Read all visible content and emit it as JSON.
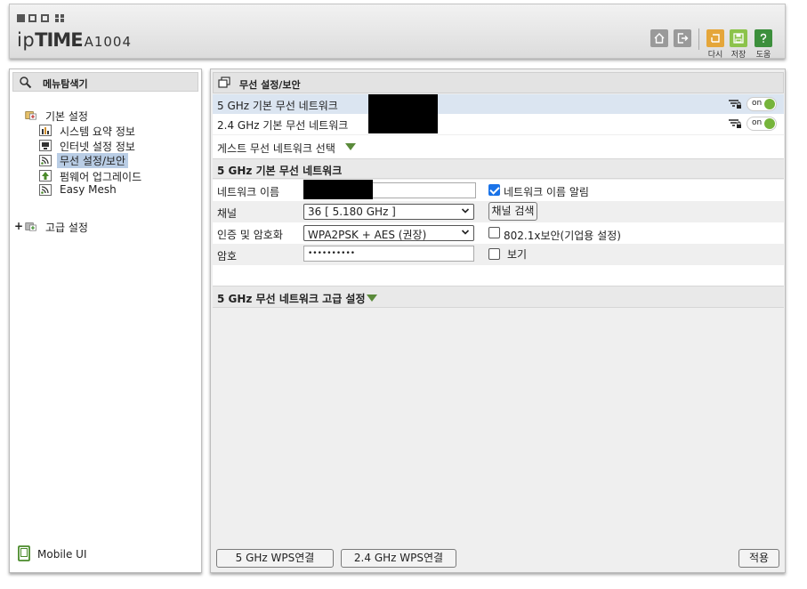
{
  "header": {
    "brand_ip": "ip",
    "brand_time": "TIME",
    "model": "A1004",
    "buttons": {
      "reset_label": "다시",
      "save_label": "저장",
      "help_label": "도움"
    }
  },
  "sidebar": {
    "title": "메뉴탐색기",
    "basic": {
      "label": "기본 설정",
      "items": [
        {
          "label": "시스템 요약 정보",
          "icon": "chart-icon"
        },
        {
          "label": "인터넷 설정 정보",
          "icon": "computer-icon"
        },
        {
          "label": "무선 설정/보안",
          "icon": "wireless-icon",
          "selected": true
        },
        {
          "label": "펌웨어 업그레이드",
          "icon": "firmware-icon"
        },
        {
          "label": "Easy Mesh",
          "icon": "wireless-icon"
        }
      ]
    },
    "advanced": {
      "expander": "+",
      "label": "고급 설정"
    },
    "mobile_ui": "Mobile UI"
  },
  "main": {
    "title": "무선 설정/보안",
    "networks": [
      {
        "label": "5 GHz 기본 무선 네트워크",
        "toggle": "on"
      },
      {
        "label": "2.4 GHz 기본 무선 네트워크",
        "toggle": "on"
      }
    ],
    "guest_select": "게스트 무선 네트워크 선택",
    "basic_section": {
      "title": "5 GHz 기본 무선 네트워크",
      "network_name_label": "네트워크 이름",
      "broadcast_label": "네트워크 이름 알림",
      "broadcast_checked": true,
      "channel_label": "채널",
      "channel_value": "36 [ 5.180 GHz ]",
      "channel_search": "채널 검색",
      "auth_label": "인증 및 암호화",
      "auth_value": "WPA2PSK + AES (권장)",
      "enterprise_label": "802.1x보안(기업용 설정)",
      "enterprise_checked": false,
      "password_label": "암호",
      "password_value": "••••••••••",
      "show_label": "보기",
      "show_checked": false
    },
    "advanced_section_title": "5 GHz 무선 네트워크 고급 설정",
    "footer": {
      "wps5": "5 GHz WPS연결",
      "wps24": "2.4 GHz WPS연결",
      "apply": "적용"
    }
  },
  "colors": {
    "selected_bg": "#b9cde5",
    "network_row_highlight": "#dbe5f1",
    "toggle_green": "#76b43b",
    "reset_btn": "#e5a63a",
    "save_btn": "#8cc34b",
    "help_btn": "#3c8f3c"
  }
}
